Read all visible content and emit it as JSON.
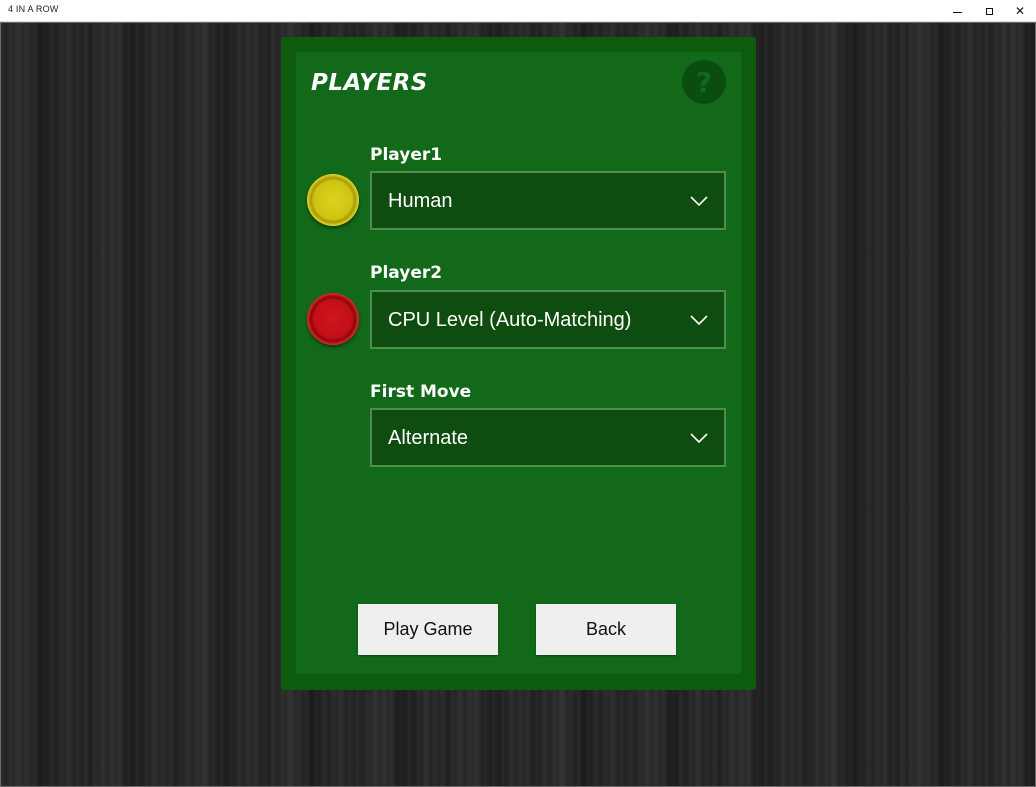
{
  "window": {
    "title": "4 IN A ROW",
    "minimize_glyph": "minimize-icon",
    "maximize_glyph": "maximize-icon",
    "close_glyph": "✕"
  },
  "panel": {
    "heading": "PLAYERS",
    "help_glyph": "?",
    "player1": {
      "label": "Player1",
      "selected": "Human",
      "token_color": "#d4c918"
    },
    "player2": {
      "label": "Player2",
      "selected": "CPU Level (Auto-Matching)",
      "token_color": "#c8121a"
    },
    "first_move": {
      "label": "First Move",
      "selected": "Alternate"
    },
    "buttons": {
      "play": "Play Game",
      "back": "Back"
    }
  },
  "colors": {
    "panel_outer": "#0d5b0d",
    "panel_inner": "#13691a",
    "select_bg": "#0f4c10",
    "select_border": "#4d8f4f",
    "button_bg": "#efefef"
  }
}
